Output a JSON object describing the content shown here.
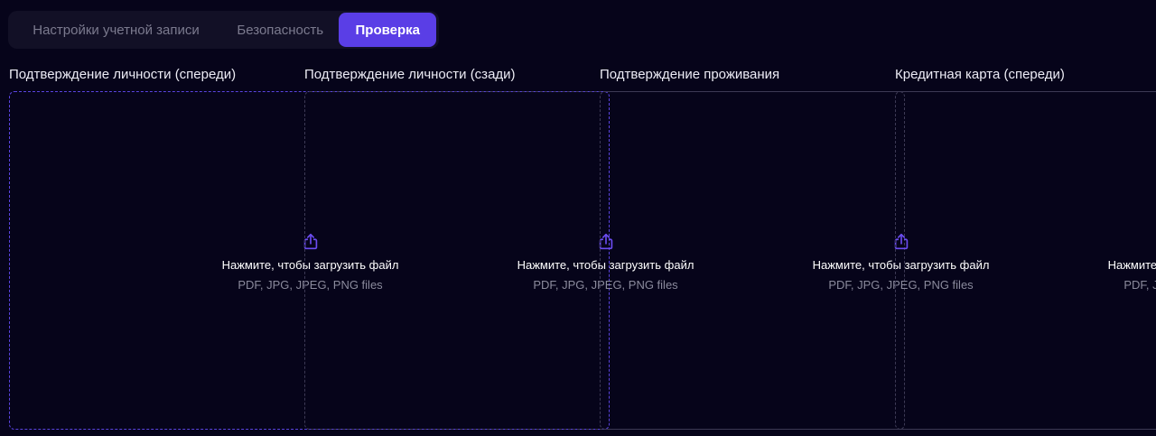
{
  "tabs": [
    {
      "label": "Настройки учетной записи",
      "active": false
    },
    {
      "label": "Безопасность",
      "active": false
    },
    {
      "label": "Проверка",
      "active": true
    }
  ],
  "uploads": [
    {
      "title": "Подтверждение личности (спереди)",
      "cta": "Нажмите, чтобы загрузить файл",
      "formats": "PDF, JPG, JPEG, PNG files"
    },
    {
      "title": "Подтверждение личности (сзади)",
      "cta": "Нажмите, чтобы загрузить файл",
      "formats": "PDF, JPG, JPEG, PNG files"
    },
    {
      "title": "Подтверждение проживания",
      "cta": "Нажмите, чтобы загрузить файл",
      "formats": "PDF, JPG, JPEG, PNG files"
    },
    {
      "title": "Кредитная карта (спереди)",
      "cta": "Нажмите, чтобы загрузить файл",
      "formats": "PDF, JPG, JPEG, PNG files"
    }
  ],
  "icons": {
    "upload": "upload-icon"
  },
  "colors": {
    "background": "#06041a",
    "accent": "#5a3ee6",
    "icon": "#6b4cf0",
    "tab_bar": "#121026"
  }
}
